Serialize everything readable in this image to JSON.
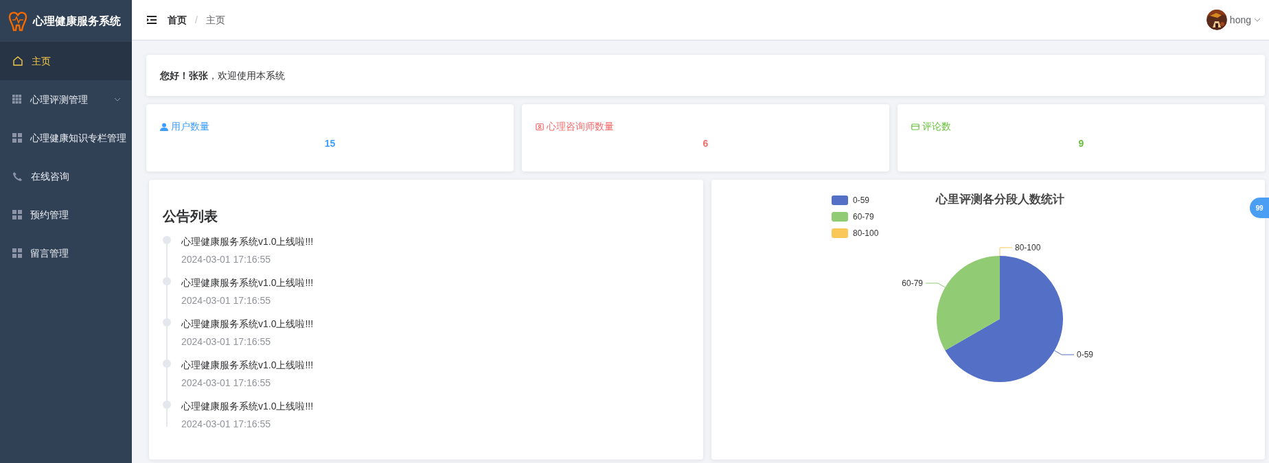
{
  "sidebar": {
    "title": "心理健康服务系统",
    "items": [
      {
        "label": "主页",
        "kind": "home",
        "selected": true
      },
      {
        "label": "心理评测管理",
        "kind": "grid",
        "selected": false,
        "expandable": true
      },
      {
        "label": "心理健康知识专栏管理",
        "kind": "tiles",
        "selected": false
      },
      {
        "label": "在线咨询",
        "kind": "phone",
        "selected": false
      },
      {
        "label": "预约管理",
        "kind": "tiles",
        "selected": false
      },
      {
        "label": "留言管理",
        "kind": "tiles",
        "selected": false
      }
    ]
  },
  "header": {
    "breadcrumb": [
      "首页",
      "主页"
    ],
    "separator": "/",
    "user": "hong"
  },
  "welcome": {
    "text": "**您好！张张**，欢迎使用本系统"
  },
  "stats": [
    {
      "label": "用户数量",
      "value": "15",
      "kind": "user",
      "color": "#409eff"
    },
    {
      "label": "心理咨询师数量",
      "value": "6",
      "kind": "badge",
      "color": "#f56c6c"
    },
    {
      "label": "评论数",
      "value": "9",
      "kind": "card",
      "color": "#67c23a"
    }
  ],
  "notices": {
    "title": "公告列表",
    "items": [
      {
        "text": "心理健康服务系统v1.0上线啦!!!",
        "time": "2024-03-01 17:16:55"
      },
      {
        "text": "心理健康服务系统v1.0上线啦!!!",
        "time": "2024-03-01 17:16:55"
      },
      {
        "text": "心理健康服务系统v1.0上线啦!!!",
        "time": "2024-03-01 17:16:55"
      },
      {
        "text": "心理健康服务系统v1.0上线啦!!!",
        "time": "2024-03-01 17:16:55"
      },
      {
        "text": "心理健康服务系统v1.0上线啦!!!",
        "time": "2024-03-01 17:16:55"
      }
    ]
  },
  "chart": {
    "chart_data": {
      "type": "pie",
      "title": "心里评测各分段人数统计",
      "categories": [
        "0-59",
        "60-79",
        "80-100"
      ],
      "series": [
        {
          "values": [
            66.7,
            33.3,
            0
          ]
        }
      ],
      "colors": [
        "#5470c6",
        "#91cc75",
        "#fac858"
      ],
      "legend": "top-left"
    }
  },
  "float_badge": "99"
}
